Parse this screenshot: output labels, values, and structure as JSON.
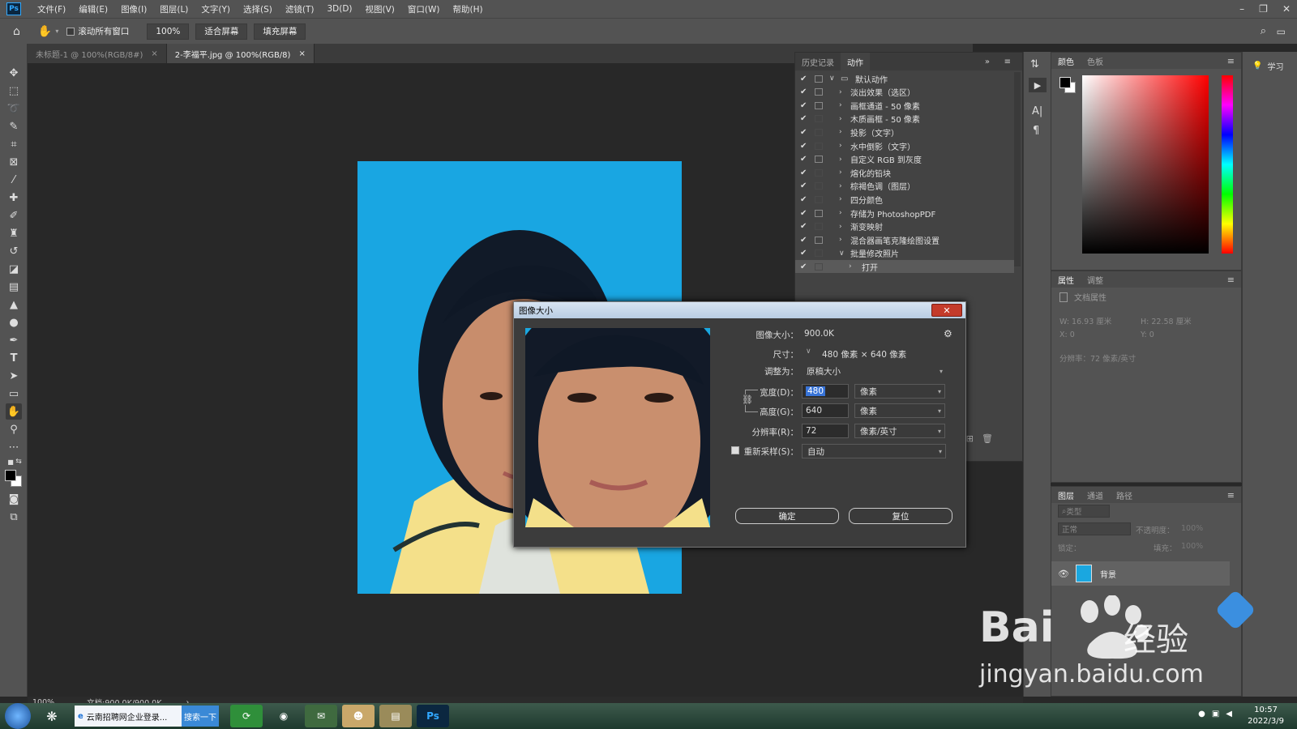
{
  "app": {
    "logo": "Ps",
    "menu": [
      "文件(F)",
      "编辑(E)",
      "图像(I)",
      "图层(L)",
      "文字(Y)",
      "选择(S)",
      "滤镜(T)",
      "3D(D)",
      "视图(V)",
      "窗口(W)",
      "帮助(H)"
    ]
  },
  "options": {
    "scroll_all": "滚动所有窗口",
    "zoom": "100%",
    "fit_screen": "适合屏幕",
    "fill_screen": "填充屏幕"
  },
  "tabs": [
    {
      "label": "未标题-1 @ 100%(RGB/8#)",
      "close": "×"
    },
    {
      "label": "2-李福平.jpg @ 100%(RGB/8)",
      "close": "×"
    }
  ],
  "actions_panel": {
    "tabs": [
      "历史记录",
      "动作"
    ],
    "rows": [
      {
        "label": "默认动作",
        "level": 0,
        "dialog": true,
        "folder": true,
        "expanded": true
      },
      {
        "label": "淡出效果（选区）",
        "level": 1,
        "dialog": true
      },
      {
        "label": "画框通道 - 50 像素",
        "level": 1,
        "dialog": true
      },
      {
        "label": "木质画框 - 50 像素",
        "level": 1,
        "dialog": false
      },
      {
        "label": "投影（文字）",
        "level": 1,
        "dialog": false
      },
      {
        "label": "水中倒影（文字）",
        "level": 1,
        "dialog": false
      },
      {
        "label": "自定义 RGB 到灰度",
        "level": 1,
        "dialog": true
      },
      {
        "label": "熔化的铅块",
        "level": 1,
        "dialog": false
      },
      {
        "label": "棕褐色调（图层）",
        "level": 1,
        "dialog": false
      },
      {
        "label": "四分颜色",
        "level": 1,
        "dialog": false
      },
      {
        "label": "存储为 PhotoshopPDF",
        "level": 1,
        "dialog": true
      },
      {
        "label": "渐变映射",
        "level": 1,
        "dialog": false
      },
      {
        "label": "混合器画笔克隆绘图设置",
        "level": 1,
        "dialog": true
      },
      {
        "label": "批量修改照片",
        "level": 1,
        "dialog": false,
        "expanded": true
      },
      {
        "label": "打开",
        "level": 2,
        "dialog": false,
        "selected": true
      }
    ]
  },
  "color_panel": {
    "tabs": [
      "颜色",
      "色板"
    ]
  },
  "props_panel": {
    "tabs": [
      "属性",
      "调整"
    ],
    "doc_props": "文档属性",
    "w": "W:  16.93 厘米",
    "h": "H:  22.58 厘米",
    "x": "X:  0",
    "y": "Y:  0",
    "resolution": "分辨率：72 像素/英寸"
  },
  "layers_panel": {
    "tabs": [
      "图层",
      "通道",
      "路径"
    ],
    "filter": "类型",
    "blend": "正常",
    "opacity_label": "不透明度：",
    "opacity": "100%",
    "lock_label": "锁定：",
    "fill_label": "填充：",
    "fill": "100%",
    "layer_name": "背景"
  },
  "learn": {
    "label": "学习"
  },
  "status": {
    "zoom": "100%",
    "doc": "文档:900.0K/900.0K"
  },
  "dialog": {
    "title": "图像大小",
    "close": "✕",
    "image_size_label": "图像大小：",
    "image_size": "900.0K",
    "dimensions_label": "尺寸：",
    "dimensions": "480 像素  ×  640 像素",
    "fit_label": "调整为：",
    "fit_value": "原稿大小",
    "width_label": "宽度(D)：",
    "width_value": "480",
    "width_unit": "像素",
    "height_label": "高度(G)：",
    "height_value": "640",
    "height_unit": "像素",
    "res_label": "分辨率(R)：",
    "res_value": "72",
    "res_unit": "像素/英寸",
    "resample_label": "重新采样(S)：",
    "resample_value": "自动",
    "ok": "确定",
    "reset": "复位"
  },
  "taskbar": {
    "ie_label": "云南招聘网企业登录...",
    "search_btn": "搜索一下",
    "time": "10:57",
    "date": "2022/3/9"
  },
  "watermark": {
    "brand": "Bai",
    "du": "经验",
    "url": "jingyan.baidu.com"
  }
}
